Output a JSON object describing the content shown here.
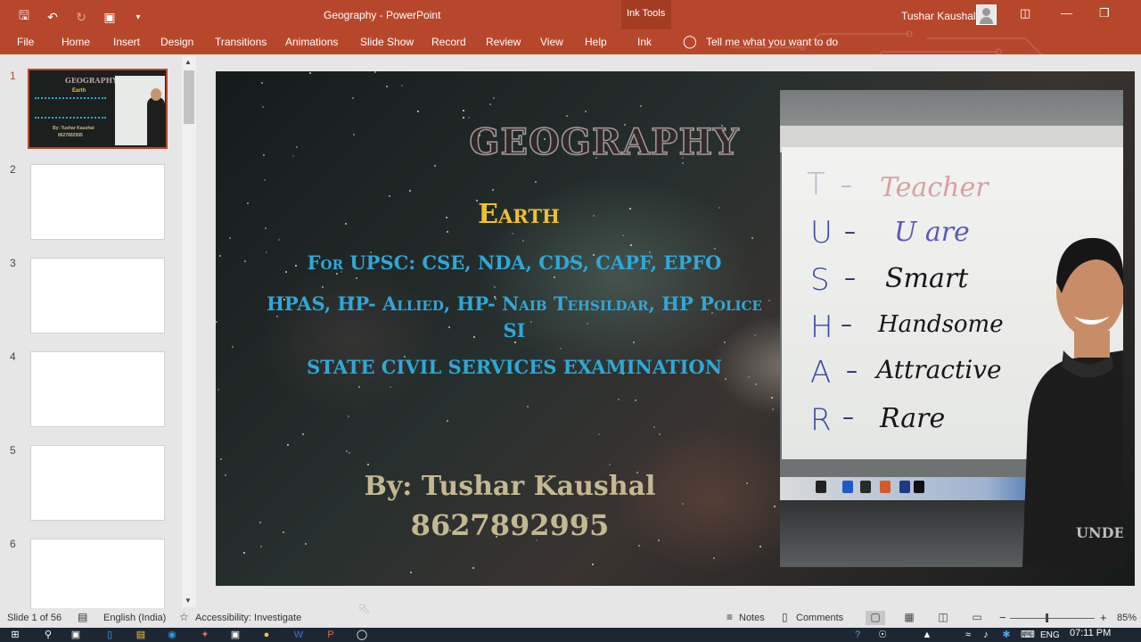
{
  "titlebar": {
    "doc_title": "Geography  -  PowerPoint",
    "context_tab": "Ink Tools",
    "user_name": "Tushar Kaushal"
  },
  "ribbon": {
    "tabs": [
      "File",
      "Home",
      "Insert",
      "Design",
      "Transitions",
      "Animations",
      "Slide Show",
      "Record",
      "Review",
      "View",
      "Help",
      "Ink"
    ],
    "tell_me": "Tell me what you want to do"
  },
  "thumbnails": {
    "slide_numbers": [
      "1",
      "2",
      "3",
      "4",
      "5",
      "6"
    ],
    "active": 1,
    "active_thumb_text": [
      "GEOGRAPHY",
      "Earth",
      "By: Tushar Kaushal",
      "8627892995"
    ]
  },
  "slide": {
    "title": "GEOGRAPHY",
    "subtitle": "Earth",
    "line1": "For UPSC: CSE, NDA, CDS, CAPF, EPFO",
    "line2": "HPAS, HP- Allied, HP- Naib Tehsildar, HP Police SI",
    "line3": "STATE CIVIL SERVICES EXAMINATION",
    "author": "By: Tushar Kaushal",
    "phone": "8627892995",
    "whiteboard": {
      "letters": [
        "T",
        "U",
        "S",
        "H",
        "A",
        "R"
      ],
      "words": [
        "Teacher",
        "U are",
        "Smart",
        "Handsome",
        "Attractive",
        "Rare"
      ]
    },
    "shirt_text": "UNDEFEATED"
  },
  "statusbar": {
    "slide_info": "Slide 1 of 56",
    "language": "English (India)",
    "accessibility": "Accessibility: Investigate",
    "notes": "Notes",
    "comments": "Comments",
    "zoom": "85%"
  },
  "taskbar": {
    "lang": "ENG",
    "time": "07:11 PM"
  }
}
